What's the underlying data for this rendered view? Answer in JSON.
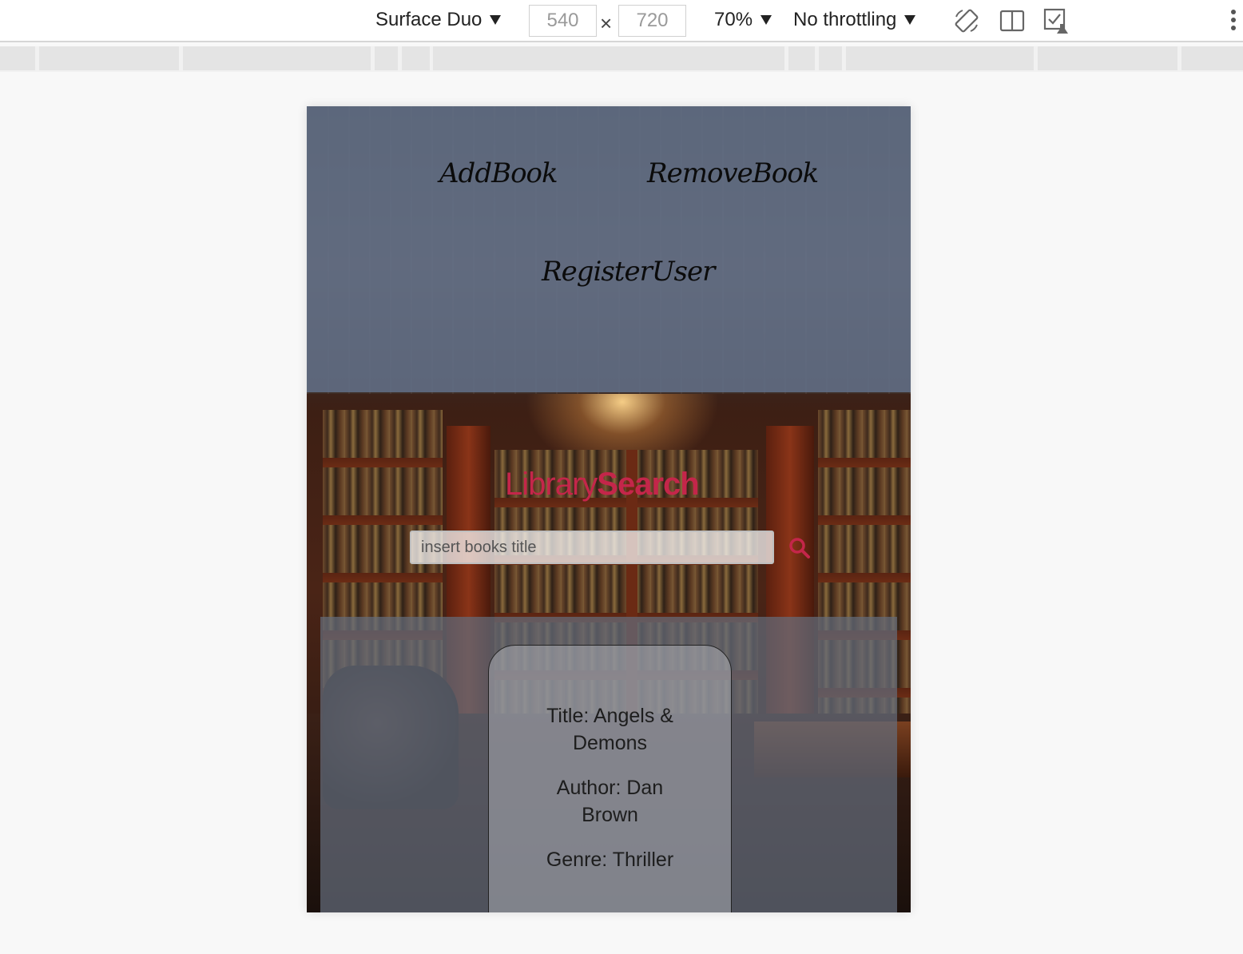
{
  "devtools": {
    "device": "Surface Duo",
    "width": "540",
    "height": "720",
    "dimension_separator": "×",
    "zoom": "70%",
    "throttling": "No throttling",
    "icons": [
      "rotate-icon",
      "dual-screen-icon",
      "sensors-icon",
      "more-icon"
    ]
  },
  "nav": {
    "add_book": "AddBook",
    "remove_book": "RemoveBook",
    "register_user": "RegisterUser"
  },
  "search": {
    "title_light": "Library",
    "title_bold": "Search",
    "placeholder": "insert books title",
    "accent_color": "#c4264a"
  },
  "results": [
    {
      "title": "Title: Angels & Demons",
      "author": "Author: Dan Brown",
      "genre": "Genre: Thriller"
    }
  ]
}
